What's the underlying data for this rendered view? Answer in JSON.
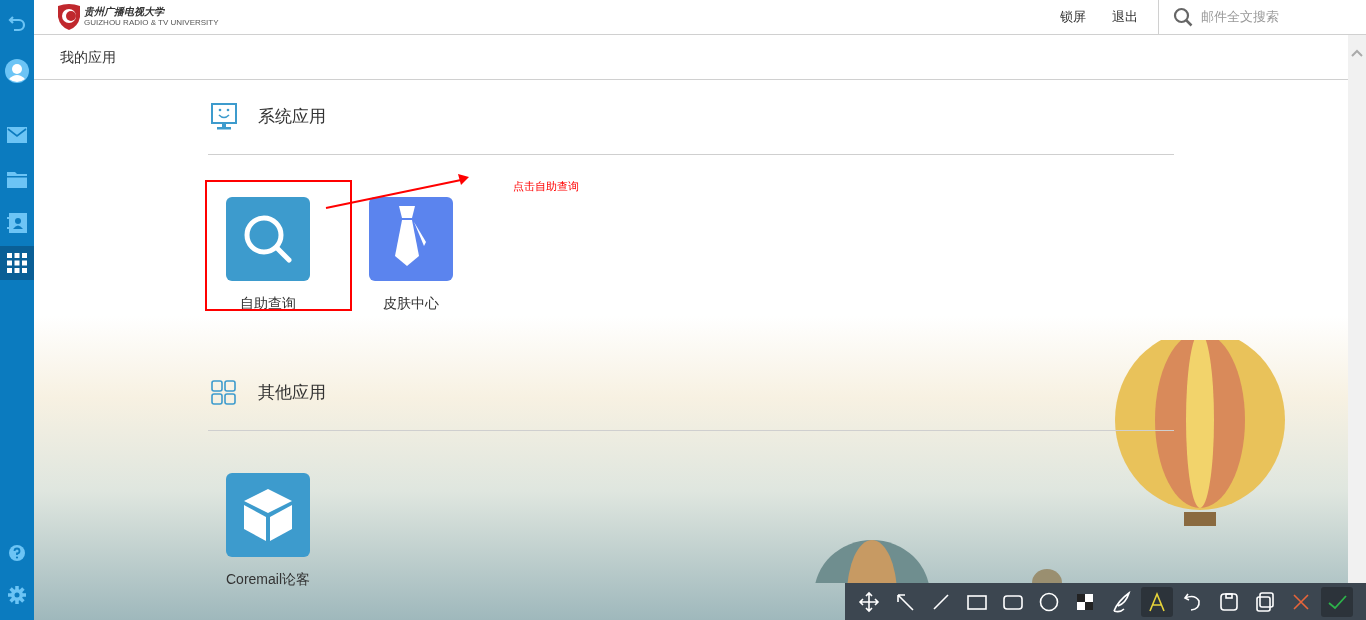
{
  "sidebar": {
    "items": [
      {
        "kind": "back",
        "selected": false
      },
      {
        "kind": "avatar",
        "selected": false
      },
      {
        "kind": "mail",
        "selected": false
      },
      {
        "kind": "folder",
        "selected": false
      },
      {
        "kind": "contacts",
        "selected": false
      },
      {
        "kind": "apps",
        "selected": true
      },
      {
        "kind": "help",
        "selected": false
      },
      {
        "kind": "settings",
        "selected": false
      }
    ]
  },
  "header": {
    "logo": {
      "title": "贵州广播电视大学",
      "subtitle": "GUIZHOU RADIO & TV UNIVERSITY"
    },
    "links": [
      "锁屏",
      "退出"
    ],
    "search": {
      "placeholder": "邮件全文搜索"
    }
  },
  "breadcrumb": "我的应用",
  "sections": [
    {
      "kind": "monitor",
      "title": "系统应用",
      "apps": [
        {
          "kind": "search",
          "label": "自助查询",
          "color": "#3d9bcd"
        },
        {
          "kind": "tie",
          "label": "皮肤中心",
          "color": "#5b84ee"
        }
      ]
    },
    {
      "kind": "grid",
      "title": "其他应用",
      "apps": [
        {
          "kind": "cube",
          "label": "Coremail论客",
          "color": "#3d9bcd"
        }
      ]
    }
  ],
  "annotation": {
    "note": "点击自助查询"
  },
  "capture_toolbar": {
    "tools": [
      {
        "kind": "move",
        "selected": false
      },
      {
        "kind": "arrow",
        "selected": false
      },
      {
        "kind": "line",
        "selected": false
      },
      {
        "kind": "rect",
        "selected": false
      },
      {
        "kind": "roundrect",
        "selected": false
      },
      {
        "kind": "circle",
        "selected": false
      },
      {
        "kind": "mosaic",
        "selected": false
      },
      {
        "kind": "pen",
        "selected": false
      },
      {
        "kind": "text",
        "selected": true
      },
      {
        "kind": "undo",
        "selected": false
      },
      {
        "kind": "save",
        "selected": false
      },
      {
        "kind": "copy",
        "selected": false
      },
      {
        "kind": "cancel",
        "selected": false
      },
      {
        "kind": "confirm",
        "selected": true
      }
    ]
  }
}
